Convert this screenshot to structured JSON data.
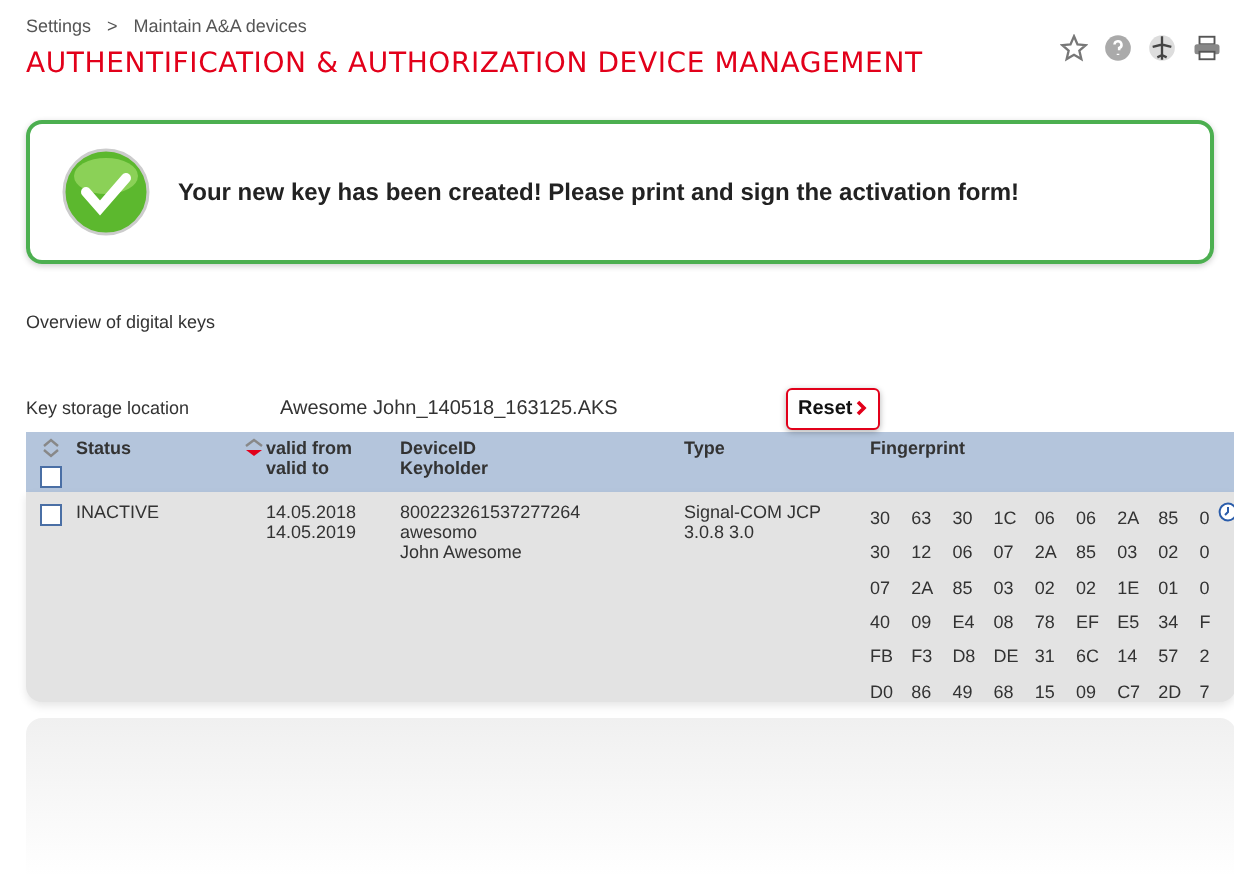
{
  "breadcrumb": [
    "Settings",
    "Maintain A&A devices"
  ],
  "breadcrumb_separator": ">",
  "title": "AUTHENTIFICATION & AUTHORIZATION DEVICE MANAGEMENT",
  "message": "Your new key has been created! Please print and sign the activation form!",
  "section_title": "Overview of digital keys",
  "storage": {
    "label": "Key storage location",
    "value": "Awesome John_140518_163125.AKS"
  },
  "reset_button": "Reset",
  "table": {
    "columns": [
      "Status",
      [
        "valid from",
        "valid to"
      ],
      [
        "DeviceID",
        "Keyholder"
      ],
      "Type",
      "Fingerprint"
    ],
    "select_all": {
      "checked": false
    },
    "rows": [
      {
        "checked": false,
        "status": "INACTIVE",
        "valid": [
          "14.05.2018",
          "14.05.2019"
        ],
        "device": [
          "800223261537277264",
          "awesomo",
          "John Awesome"
        ],
        "type": "Signal-COM JCP 3.0.8 3.0",
        "fingerprint": [
          [
            "30",
            "63",
            "30",
            "1C",
            "06",
            "06",
            "2A",
            "85",
            "0"
          ],
          [
            "30",
            "12",
            "06",
            "07",
            "2A",
            "85",
            "03",
            "02",
            "0"
          ],
          [
            "07",
            "2A",
            "85",
            "03",
            "02",
            "02",
            "1E",
            "01",
            "0"
          ],
          [
            "40",
            "09",
            "E4",
            "08",
            "78",
            "EF",
            "E5",
            "34",
            "F"
          ],
          [
            "FB",
            "F3",
            "D8",
            "DE",
            "31",
            "6C",
            "14",
            "57",
            "2"
          ],
          [
            "D0",
            "86",
            "49",
            "68",
            "15",
            "09",
            "C7",
            "2D",
            "7"
          ]
        ]
      }
    ]
  }
}
